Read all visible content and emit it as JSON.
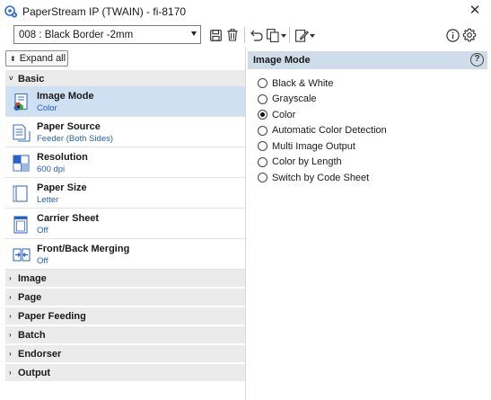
{
  "window": {
    "title": "PaperStream IP (TWAIN) - fi-8170",
    "close_glyph": "✕"
  },
  "toolbar": {
    "profile_value": "008 : Black Border -2mm"
  },
  "left": {
    "expand_all_label": "Expand all",
    "basic_header": "Basic",
    "items": [
      {
        "label": "Image Mode",
        "value": "Color",
        "icon": "image-mode-icon"
      },
      {
        "label": "Paper Source",
        "value": "Feeder (Both Sides)",
        "icon": "paper-source-icon"
      },
      {
        "label": "Resolution",
        "value": "600 dpi",
        "icon": "resolution-icon"
      },
      {
        "label": "Paper Size",
        "value": "Letter",
        "icon": "paper-size-icon"
      },
      {
        "label": "Carrier Sheet",
        "value": "Off",
        "icon": "carrier-sheet-icon"
      },
      {
        "label": "Front/Back Merging",
        "value": "Off",
        "icon": "front-back-merging-icon"
      }
    ],
    "sections": [
      "Image",
      "Page",
      "Paper Feeding",
      "Batch",
      "Endorser",
      "Output"
    ]
  },
  "right": {
    "header": "Image Mode",
    "options": [
      {
        "label": "Black & White",
        "checked": false
      },
      {
        "label": "Grayscale",
        "checked": false
      },
      {
        "label": "Color",
        "checked": true
      },
      {
        "label": "Automatic Color Detection",
        "checked": false
      },
      {
        "label": "Multi Image Output",
        "checked": false
      },
      {
        "label": "Color by Length",
        "checked": false
      },
      {
        "label": "Switch by Code Sheet",
        "checked": false
      }
    ]
  },
  "colors": {
    "selected_row": "#cfe0f3",
    "header_bg": "#cfdcea",
    "value_text": "#2460b8",
    "section_bg": "#ebebeb"
  }
}
